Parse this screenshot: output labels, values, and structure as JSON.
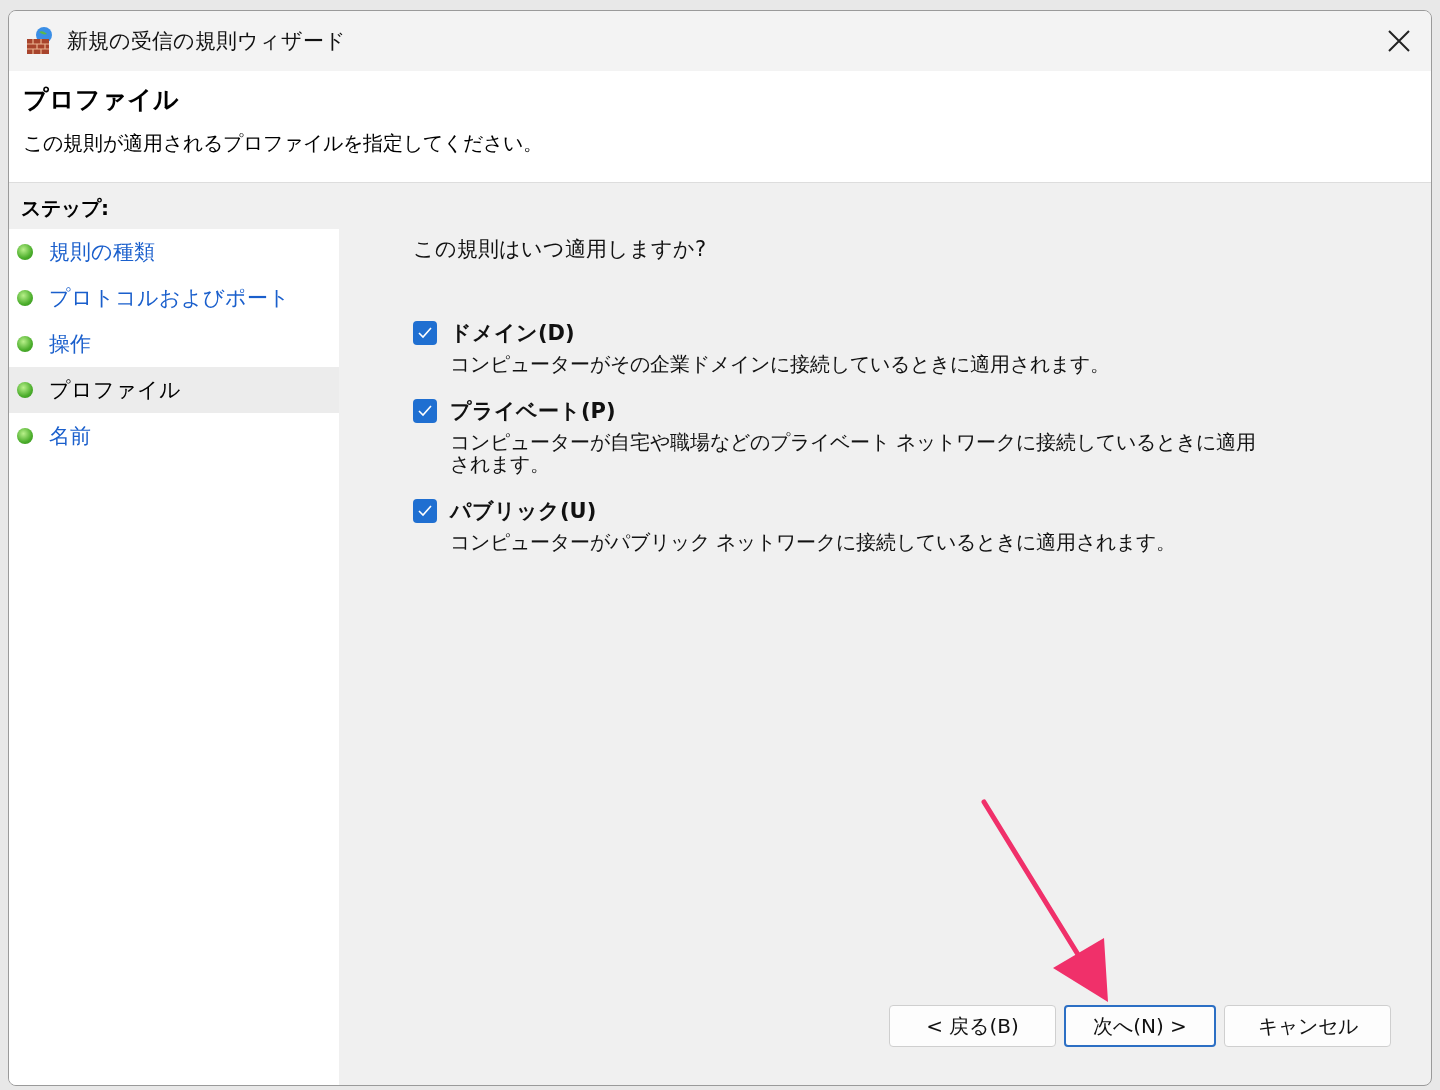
{
  "window": {
    "title": "新規の受信の規則ウィザード"
  },
  "header": {
    "title": "プロファイル",
    "subtitle": "この規則が適用されるプロファイルを指定してください。"
  },
  "steps": {
    "heading": "ステップ:",
    "items": [
      {
        "label": "規則の種類",
        "selected": false
      },
      {
        "label": "プロトコルおよびポート",
        "selected": false
      },
      {
        "label": "操作",
        "selected": false
      },
      {
        "label": "プロファイル",
        "selected": true
      },
      {
        "label": "名前",
        "selected": false
      }
    ]
  },
  "question": "この規則はいつ適用しますか?",
  "options": [
    {
      "label": "ドメイン(D)",
      "description": "コンピューターがその企業ドメインに接続しているときに適用されます。",
      "checked": true
    },
    {
      "label": "プライベート(P)",
      "description": "コンピューターが自宅や職場などのプライベート ネットワークに接続しているときに適用されます。",
      "checked": true
    },
    {
      "label": "パブリック(U)",
      "description": "コンピューターがパブリック ネットワークに接続しているときに適用されます。",
      "checked": true
    }
  ],
  "buttons": [
    {
      "label": "< 戻る(B)",
      "default": false
    },
    {
      "label": "次へ(N) >",
      "default": true
    },
    {
      "label": "キャンセル",
      "default": false
    }
  ]
}
